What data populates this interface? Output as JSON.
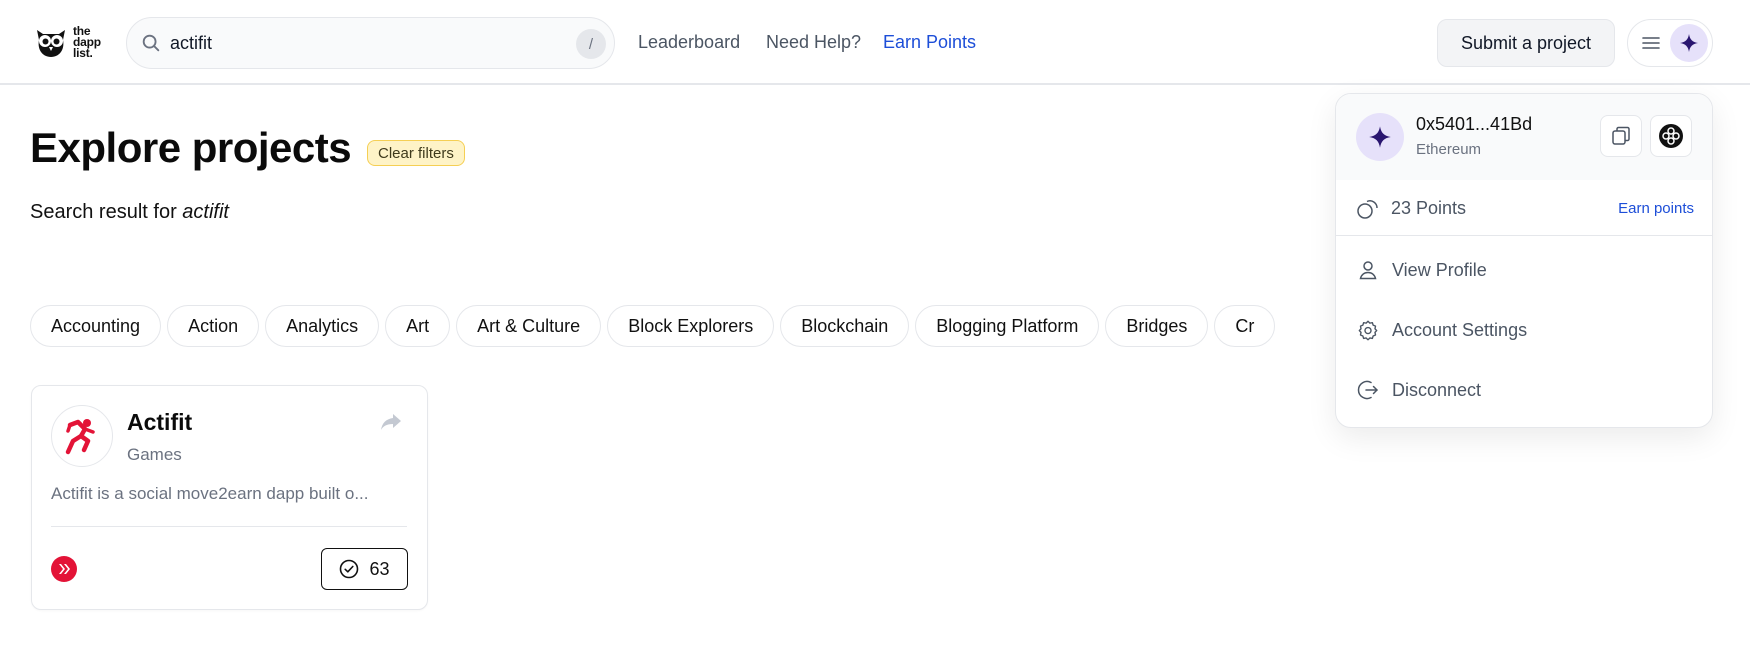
{
  "header": {
    "logo_text": [
      "the",
      "dapp",
      "list."
    ],
    "search": {
      "value": "actifit",
      "shortcut": "/"
    },
    "nav": [
      "Leaderboard",
      "Need Help?",
      "Earn Points"
    ],
    "submit_label": "Submit a project"
  },
  "main": {
    "title": "Explore projects",
    "clear_filters": "Clear filters",
    "search_result_prefix": "Search result for",
    "search_term": "actifit",
    "categories": [
      "Accounting",
      "Action",
      "Analytics",
      "Art",
      "Art & Culture",
      "Block Explorers",
      "Blockchain",
      "Blogging Platform",
      "Bridges",
      "Cr"
    ]
  },
  "card": {
    "name": "Actifit",
    "category": "Games",
    "description": "Actifit is a social move2earn dapp built o...",
    "votes": "63"
  },
  "dropdown": {
    "address": "0x5401...41Bd",
    "network": "Ethereum",
    "points": "23 Points",
    "earn_points": "Earn points",
    "items": [
      "View Profile",
      "Account Settings",
      "Disconnect"
    ]
  },
  "colors": {
    "accent_link": "#1d4ed8",
    "avatar_bg": "#e6e1fa",
    "avatar_star": "#2a1670",
    "clear_filters_bg": "#fef3c7",
    "brand_red": "#e31337"
  }
}
